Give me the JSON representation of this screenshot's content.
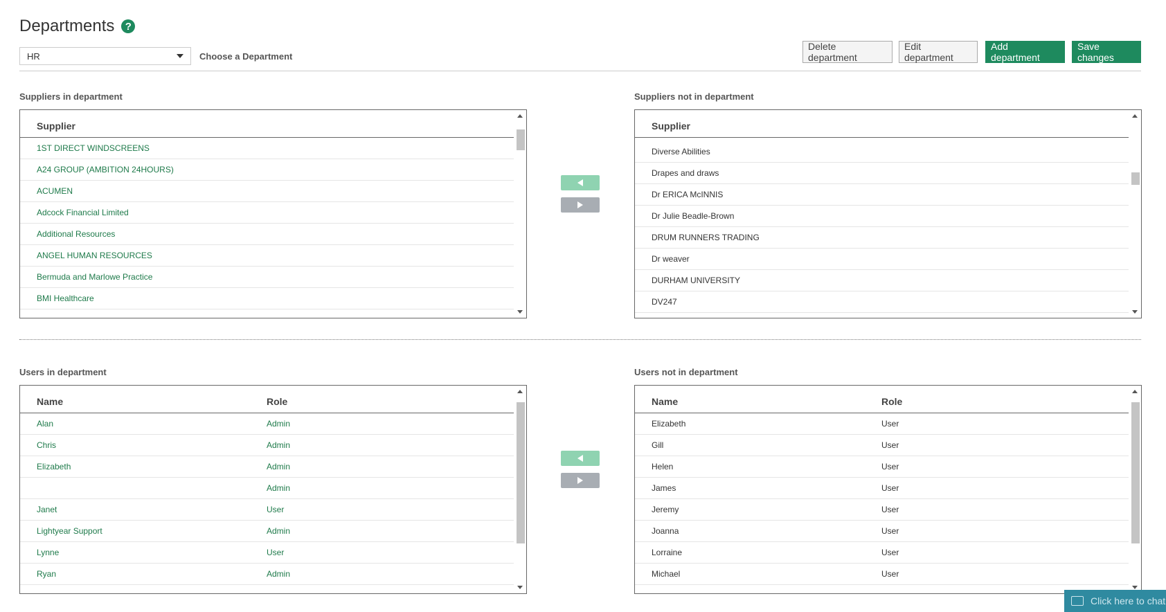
{
  "header": {
    "title": "Departments",
    "help_symbol": "?",
    "selected_department": "HR",
    "choose_label": "Choose a Department"
  },
  "toolbar": {
    "delete_label": "Delete department",
    "edit_label": "Edit department",
    "add_label": "Add department",
    "save_label": "Save changes"
  },
  "suppliers_in": {
    "label": "Suppliers in department",
    "column": "Supplier",
    "items": [
      "1ST DIRECT WINDSCREENS",
      "A24 GROUP (AMBITION 24HOURS)",
      "ACUMEN",
      "Adcock Financial Limited",
      "Additional Resources",
      "ANGEL HUMAN RESOURCES",
      "Bermuda and Marlowe Practice",
      "BMI Healthcare"
    ]
  },
  "suppliers_out": {
    "label": "Suppliers not in department",
    "column": "Supplier",
    "items": [
      "Diverse Abilities",
      "Drapes and draws",
      "Dr ERICA McINNIS",
      "Dr Julie Beadle-Brown",
      "DRUM RUNNERS TRADING",
      "Dr weaver",
      "DURHAM UNIVERSITY",
      "DV247"
    ]
  },
  "users_in": {
    "label": "Users in department",
    "columns": [
      "Name",
      "Role"
    ],
    "rows": [
      {
        "name": "Alan",
        "role": "Admin"
      },
      {
        "name": "Chris",
        "role": "Admin"
      },
      {
        "name": "Elizabeth",
        "role": "Admin"
      },
      {
        "name": "",
        "role": "Admin"
      },
      {
        "name": "Janet",
        "role": "User"
      },
      {
        "name": "Lightyear Support",
        "role": "Admin"
      },
      {
        "name": "Lynne",
        "role": "User"
      },
      {
        "name": "Ryan",
        "role": "Admin"
      }
    ]
  },
  "users_out": {
    "label": "Users not in department",
    "columns": [
      "Name",
      "Role"
    ],
    "rows": [
      {
        "name": "Elizabeth",
        "role": "User"
      },
      {
        "name": "Gill",
        "role": "User"
      },
      {
        "name": "Helen",
        "role": "User"
      },
      {
        "name": "James",
        "role": "User"
      },
      {
        "name": "Jeremy",
        "role": "User"
      },
      {
        "name": "Joanna",
        "role": "User"
      },
      {
        "name": "Lorraine",
        "role": "User"
      },
      {
        "name": "Michael",
        "role": "User"
      }
    ]
  },
  "chat": {
    "label": "Click here to chat"
  },
  "colors": {
    "accent": "#1e8a5e",
    "move_left": "#8fd3b1",
    "move_right": "#a8adb3",
    "chat": "#2f8aa0"
  }
}
